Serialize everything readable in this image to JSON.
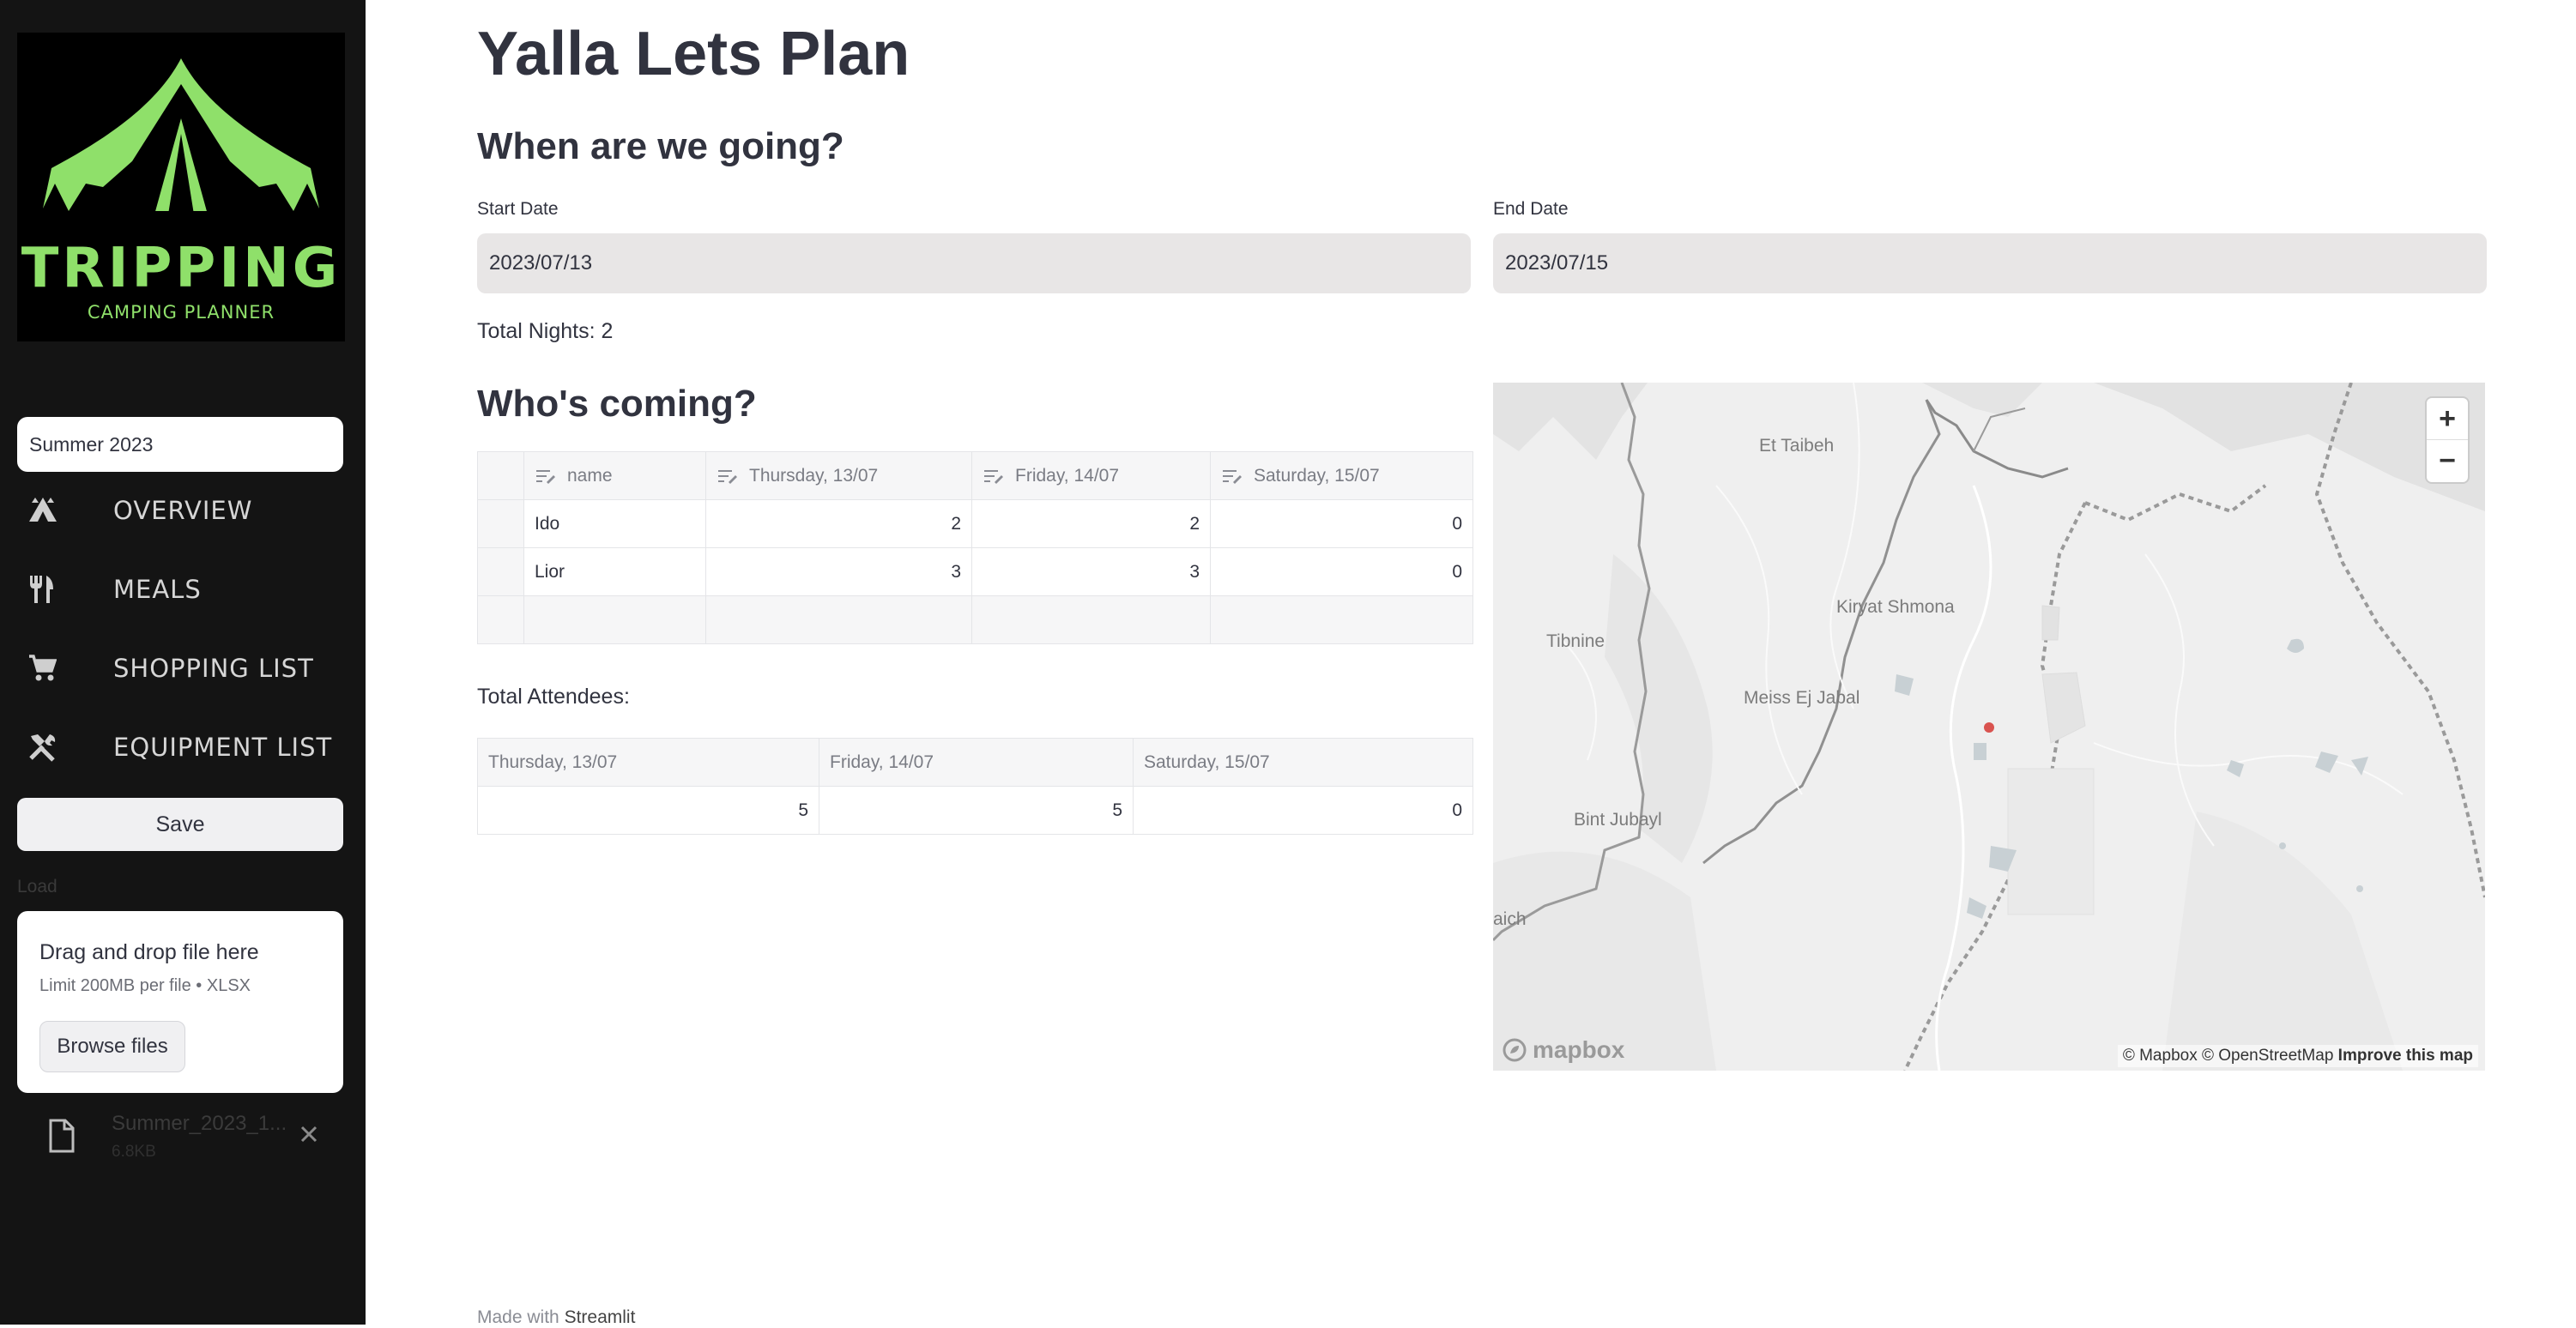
{
  "sidebar": {
    "logo": {
      "title": "TRIPPING",
      "subtitle": "CAMPING PLANNER",
      "color": "#8fe06a"
    },
    "trip_name": "Summer 2023",
    "nav": [
      {
        "label": "OVERVIEW",
        "icon": "tent-icon"
      },
      {
        "label": "MEALS",
        "icon": "cutlery-icon"
      },
      {
        "label": "SHOPPING LIST",
        "icon": "cart-icon"
      },
      {
        "label": "EQUIPMENT LIST",
        "icon": "tools-icon"
      }
    ],
    "save_label": "Save",
    "load_label": "Load",
    "uploader": {
      "drag_text": "Drag and drop file here",
      "limit_text": "Limit 200MB per file • XLSX",
      "browse_label": "Browse files"
    },
    "file": {
      "name": "Summer_2023_1...",
      "size": "6.8KB"
    }
  },
  "main": {
    "title": "Yalla Lets Plan",
    "when_heading": "When are we going?",
    "start_date": {
      "label": "Start Date",
      "value": "2023/07/13"
    },
    "end_date": {
      "label": "End Date",
      "value": "2023/07/15"
    },
    "total_nights": "Total Nights: 2",
    "who_heading": "Who's coming?",
    "attendees_table": {
      "columns": [
        "name",
        "Thursday, 13/07",
        "Friday, 14/07",
        "Saturday, 15/07"
      ],
      "rows": [
        [
          "Ido",
          "2",
          "2",
          "0"
        ],
        [
          "Lior",
          "3",
          "3",
          "0"
        ]
      ]
    },
    "total_attendees_label": "Total Attendees:",
    "totals_table": {
      "columns": [
        "Thursday, 13/07",
        "Friday, 14/07",
        "Saturday, 15/07"
      ],
      "values": [
        "5",
        "5",
        "0"
      ]
    }
  },
  "map": {
    "labels": [
      "Et Taibeh",
      "Kiryat Shmona",
      "Tibnine",
      "Meiss Ej Jabal",
      "Bint Jubayl",
      "aich"
    ],
    "zoom_in": "+",
    "zoom_out": "−",
    "logo_text": "mapbox",
    "attribution": "© Mapbox © OpenStreetMap",
    "improve": "Improve this map",
    "marker_color": "#d9534f"
  },
  "footer": {
    "prefix": "Made with",
    "brand": "Streamlit"
  }
}
